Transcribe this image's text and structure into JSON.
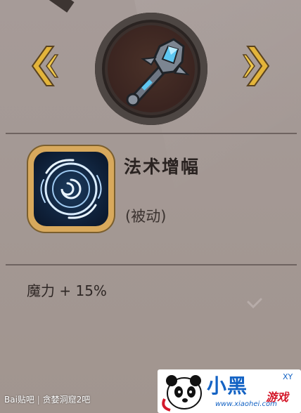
{
  "skill": {
    "name": "法术增幅",
    "type": "(被动)"
  },
  "stats": {
    "line": "魔力 + 15%"
  },
  "footer": {
    "source": "Bai",
    "source_suffix": "贴吧",
    "separator": "|",
    "forum": "贪婪洞窟2吧"
  },
  "watermark": {
    "title": "小黑",
    "tag": "游戏",
    "tag_small": "XY",
    "url": "www.xiaohei.com"
  },
  "colors": {
    "background": "#a69b98",
    "arrow_gold": "#e3b43a",
    "frame_gold": "#d8a95c",
    "skill_blue": "#0e1f37",
    "gem_blue": "#5ec7f2"
  },
  "icons": {
    "left_nav": "chevron-left-double-icon",
    "right_nav": "chevron-right-double-icon",
    "item": "staff-icon",
    "skill": "swirl-icon"
  }
}
